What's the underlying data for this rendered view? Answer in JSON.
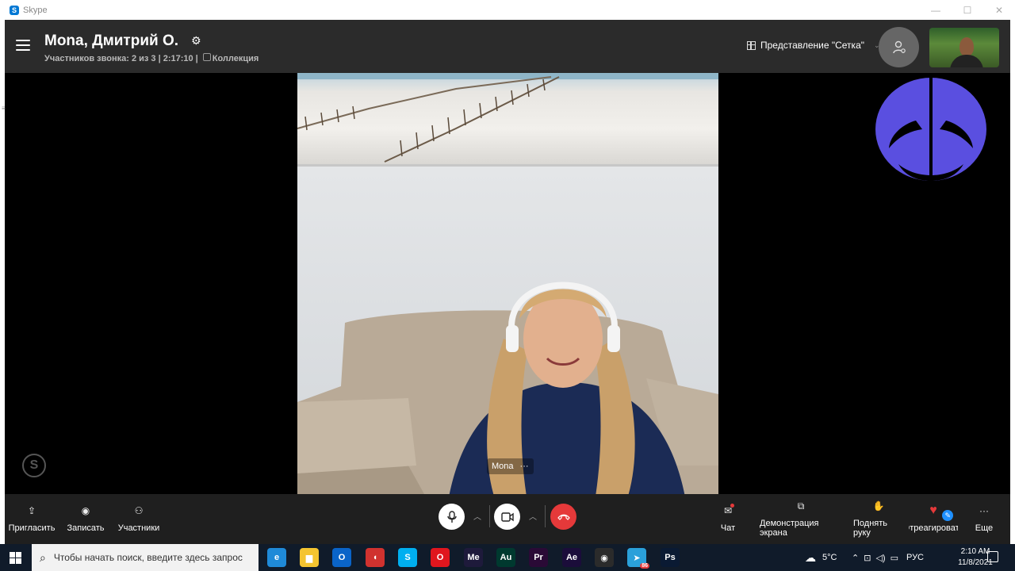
{
  "window": {
    "title": "Skype",
    "minimize": "—",
    "maximize": "☐",
    "close": "✕"
  },
  "header": {
    "call_title": "Mona, Дмитрий О.",
    "subtitle": "Участников звонка: 2 из 3 | 2:17:10 |",
    "collection": "Коллекция",
    "view_mode": "Представление \"Сетка\""
  },
  "video": {
    "participant_name": "Mona",
    "more": "···"
  },
  "toolbar": {
    "invite": "Пригласить",
    "record": "Записать",
    "participants": "Участники",
    "chat": "Чат",
    "share_screen": "Демонстрация экрана",
    "raise_hand": "Поднять руку",
    "react": "Отреагировать",
    "more": "Еще"
  },
  "taskbar": {
    "search_placeholder": "Чтобы начать поиск, введите здесь запрос",
    "apps": [
      {
        "name": "Edge",
        "label": "e",
        "color": "#1f8ad8"
      },
      {
        "name": "Explorer",
        "label": "▆",
        "color": "#f4c430"
      },
      {
        "name": "Outlook",
        "label": "O",
        "color": "#0a64c8"
      },
      {
        "name": "Bridge",
        "label": "◖",
        "color": "#d0322f"
      },
      {
        "name": "Skype",
        "label": "S",
        "color": "#00aff0"
      },
      {
        "name": "Opera",
        "label": "O",
        "color": "#e0161e"
      },
      {
        "name": "Media Encoder",
        "label": "Me",
        "color": "#1e1a3b"
      },
      {
        "name": "Audition",
        "label": "Au",
        "color": "#00392f"
      },
      {
        "name": "Premiere",
        "label": "Pr",
        "color": "#2a0a36"
      },
      {
        "name": "After Effects",
        "label": "Ae",
        "color": "#1b0d3a"
      },
      {
        "name": "OBS",
        "label": "◉",
        "color": "#2b2b2b"
      },
      {
        "name": "Telegram",
        "label": "➤",
        "color": "#2aa0da"
      },
      {
        "name": "Photoshop",
        "label": "Ps",
        "color": "#0a1a33"
      }
    ],
    "weather": "5°C",
    "language": "РУС",
    "time": "2:10 AM",
    "date": "11/8/2021",
    "telegram_badge": "86"
  },
  "colors": {
    "end_call": "#e5393a",
    "logo": "#5a4fe0",
    "header_bg": "#2b2b2b",
    "toolbar_bg": "#1f1f1f"
  }
}
